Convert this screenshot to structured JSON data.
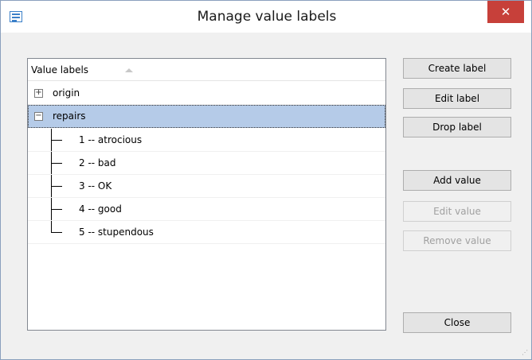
{
  "window": {
    "title": "Manage value labels",
    "close_glyph": "✕"
  },
  "list": {
    "column_header": "Value labels",
    "items": [
      {
        "expander": "+",
        "label": "origin"
      },
      {
        "expander": "−",
        "label": "repairs"
      }
    ],
    "children": [
      "1 -- atrocious",
      "2 -- bad",
      "3 -- OK",
      "4 -- good",
      "5 -- stupendous"
    ]
  },
  "buttons": {
    "create_label": "Create label",
    "edit_label": "Edit label",
    "drop_label": "Drop label",
    "add_value": "Add value",
    "edit_value": "Edit value",
    "remove_value": "Remove value",
    "close": "Close"
  },
  "colors": {
    "selection": "#b5cbe8",
    "close_button": "#c7403a"
  }
}
